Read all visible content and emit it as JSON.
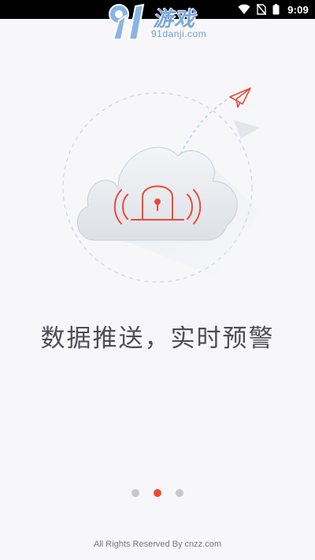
{
  "status_bar": {
    "time": "9:09",
    "icons": [
      "wifi-icon",
      "no-sim-icon",
      "battery-icon"
    ]
  },
  "watermark": {
    "brand": "游戏",
    "domain": "91danji.com"
  },
  "onboarding": {
    "headline": "数据推送，实时预警",
    "page_total": 3,
    "current_page": 2
  },
  "footer": {
    "copyright": "All Rights Reserved By cnzz.com"
  },
  "colors": {
    "accent": "#ec4b36",
    "background": "#f7f7fa",
    "text": "#4d4d55"
  }
}
